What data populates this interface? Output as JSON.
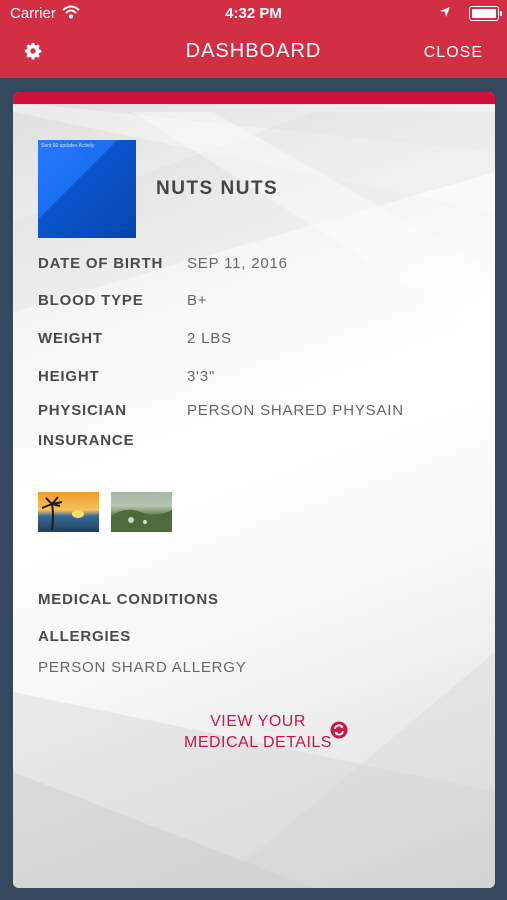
{
  "status_bar": {
    "carrier": "Carrier",
    "time": "4:32 PM"
  },
  "nav": {
    "title": "DASHBOARD",
    "close_label": "CLOSE"
  },
  "profile": {
    "avatar_text": "Sent 60 updates Activity",
    "name": "NUTS NUTS"
  },
  "details": {
    "date_of_birth": {
      "label": "DATE OF BIRTH",
      "value": "SEP 11, 2016"
    },
    "blood_type": {
      "label": "BLOOD TYPE",
      "value": "B+"
    },
    "weight": {
      "label": "WEIGHT",
      "value": "2 LBS"
    },
    "height": {
      "label": "HEIGHT",
      "value": "3'3\""
    },
    "physician": {
      "label": "PHYSICIAN",
      "value": "PERSON SHARED PHYSAIN"
    },
    "insurance": {
      "label": "INSURANCE",
      "value": ""
    }
  },
  "medical": {
    "conditions_label": "MEDICAL CONDITIONS",
    "allergies_label": "ALLERGIES",
    "allergies_value": "PERSON SHARD ALLERGY"
  },
  "action": {
    "line1": "VIEW YOUR",
    "line2": "MEDICAL DETAILS"
  },
  "colors": {
    "header": "#d22f45",
    "accent": "#c41a44",
    "background": "#34495e"
  }
}
